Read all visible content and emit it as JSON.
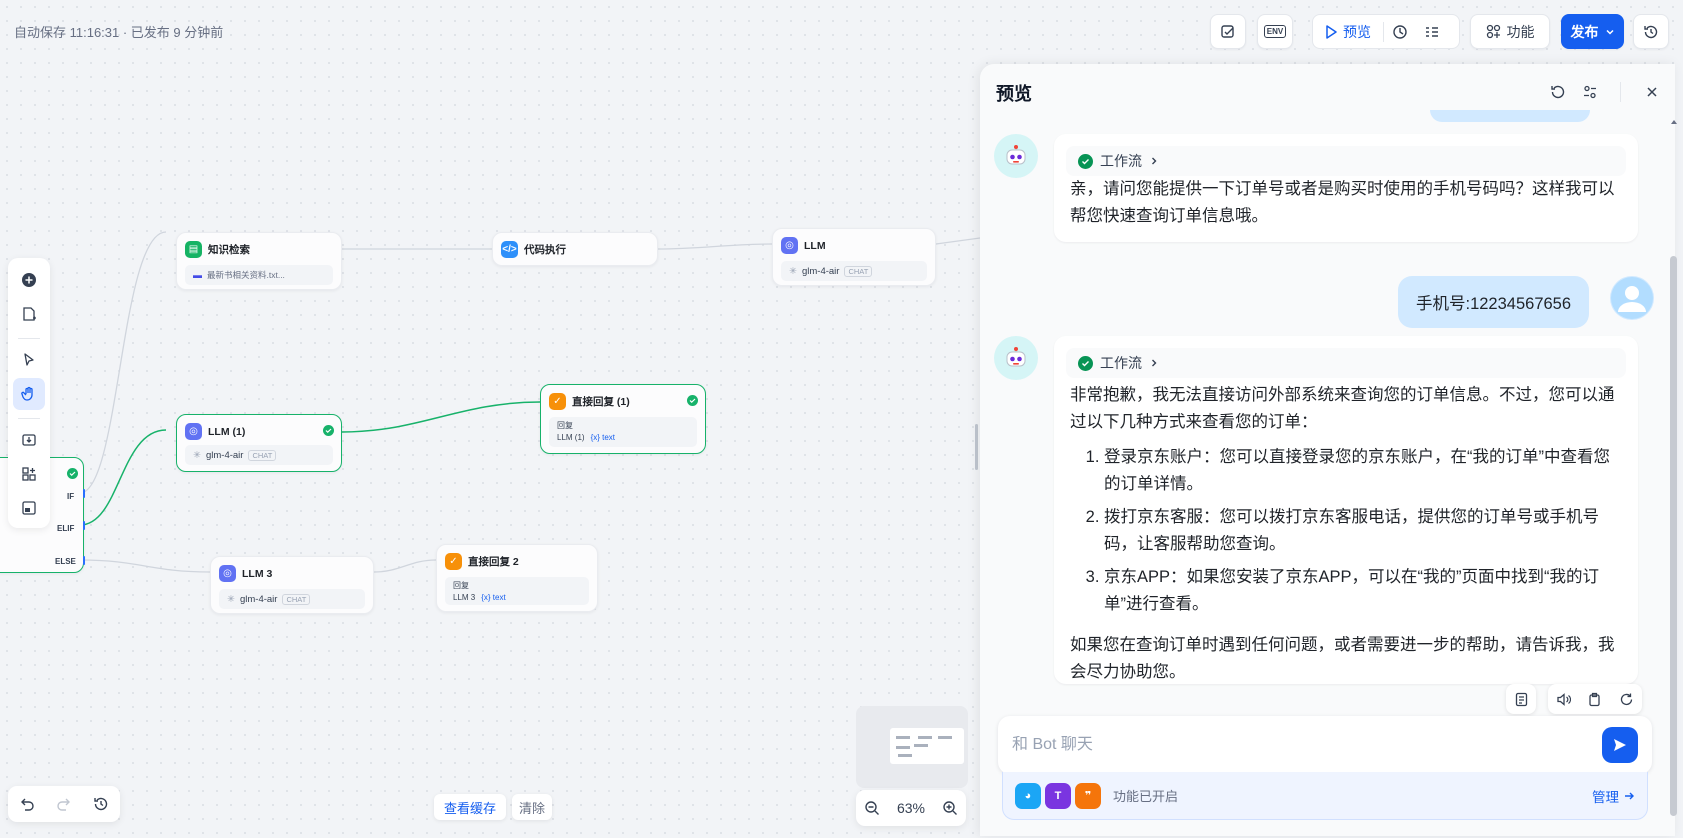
{
  "topbar": {
    "autosave": "自动保存 11:16:31 · 已发布 9 分钟前",
    "preview_label": "预览",
    "features_label": "功能",
    "publish_label": "发布",
    "env_label": "ENV"
  },
  "nodes": {
    "knowledge": {
      "title": "知识检索",
      "file": "最新书相关资料.txt..."
    },
    "code": {
      "title": "代码执行"
    },
    "llm": {
      "title": "LLM",
      "model": "glm-4-air",
      "tag": "CHAT"
    },
    "llm1": {
      "title": "LLM (1)",
      "model": "glm-4-air",
      "tag": "CHAT"
    },
    "reply1": {
      "title": "直接回复 (1)",
      "sub": "回复",
      "ref": "LLM (1)",
      "var": "{x} text"
    },
    "llm3": {
      "title": "LLM 3",
      "model": "glm-4-air",
      "tag": "CHAT"
    },
    "reply2": {
      "title": "直接回复 2",
      "sub": "回复",
      "ref": "LLM 3",
      "var": "{x} text"
    },
    "ifelse": {
      "if": "IF",
      "elif": "ELIF",
      "else": "ELSE"
    }
  },
  "bottom": {
    "view_cache": "查看缓存",
    "clear": "清除",
    "zoom": "63%"
  },
  "panel": {
    "title": "预览",
    "workflow_label": "工作流",
    "bot_msg1": "亲，请问您能提供一下订单号或者是购买时使用的手机号码吗？这样我可以帮您快速查询订单信息哦。",
    "user_msg": "手机号:12234567656",
    "bot_msg2_intro": "非常抱歉，我无法直接访问外部系统来查询您的订单信息。不过，您可以通过以下几种方式来查看您的订单：",
    "bot_msg2_list": [
      "登录京东账户：您可以直接登录您的京东账户，在“我的订单”中查看您的订单详情。",
      "拨打京东客服：您可以拨打京东客服电话，提供您的订单号或手机号码，让客服帮助您查询。",
      "京东APP：如果您安装了京东APP，可以在“我的”页面中找到“我的订单”进行查看。"
    ],
    "bot_msg2_outro": "如果您在查询订单时遇到任何问题，或者需要进一步的帮助，请告诉我，我会尽力协助您。",
    "input_placeholder": "和 Bot 聊天",
    "features_enabled": "功能已开启",
    "manage_label": "管理"
  },
  "colors": {
    "accent": "#155eef",
    "success": "#17b26a",
    "user_bubble": "#d1e9ff"
  }
}
